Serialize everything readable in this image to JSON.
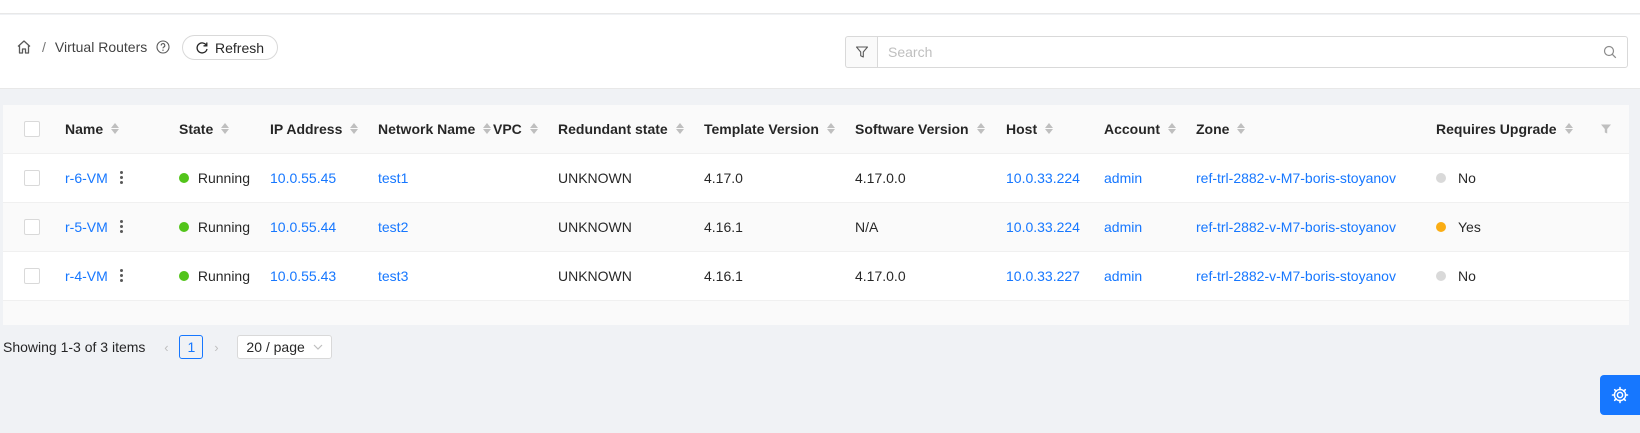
{
  "breadcrumb": {
    "title": "Virtual Routers"
  },
  "toolbar": {
    "refresh_label": "Refresh"
  },
  "search": {
    "placeholder": "Search"
  },
  "table": {
    "columns": [
      "Name",
      "State",
      "IP Address",
      "Network Name",
      "VPC",
      "Redundant state",
      "Template Version",
      "Software Version",
      "Host",
      "Account",
      "Zone",
      "Requires Upgrade"
    ],
    "rows": [
      {
        "name": "r-6-VM",
        "state": "Running",
        "state_color": "#52c41a",
        "ip": "10.0.55.45",
        "network": "test1",
        "vpc": "",
        "redundant": "UNKNOWN",
        "template": "4.17.0",
        "software": "4.17.0.0",
        "host": "10.0.33.224",
        "account": "admin",
        "zone": "ref-trl-2882-v-M7-boris-stoyanov",
        "upgrade": "No",
        "upgrade_color": "#d9d9d9"
      },
      {
        "name": "r-5-VM",
        "state": "Running",
        "state_color": "#52c41a",
        "ip": "10.0.55.44",
        "network": "test2",
        "vpc": "",
        "redundant": "UNKNOWN",
        "template": "4.16.1",
        "software": "N/A",
        "host": "10.0.33.224",
        "account": "admin",
        "zone": "ref-trl-2882-v-M7-boris-stoyanov",
        "upgrade": "Yes",
        "upgrade_color": "#faad14"
      },
      {
        "name": "r-4-VM",
        "state": "Running",
        "state_color": "#52c41a",
        "ip": "10.0.55.43",
        "network": "test3",
        "vpc": "",
        "redundant": "UNKNOWN",
        "template": "4.16.1",
        "software": "4.17.0.0",
        "host": "10.0.33.227",
        "account": "admin",
        "zone": "ref-trl-2882-v-M7-boris-stoyanov",
        "upgrade": "No",
        "upgrade_color": "#d9d9d9"
      }
    ]
  },
  "pagination": {
    "summary": "Showing 1-3 of 3 items",
    "current_page": "1",
    "page_size": "20 / page"
  },
  "colors": {
    "accent": "#1677ff",
    "running": "#52c41a",
    "upgrade_yes": "#faad14",
    "upgrade_no": "#d9d9d9"
  }
}
